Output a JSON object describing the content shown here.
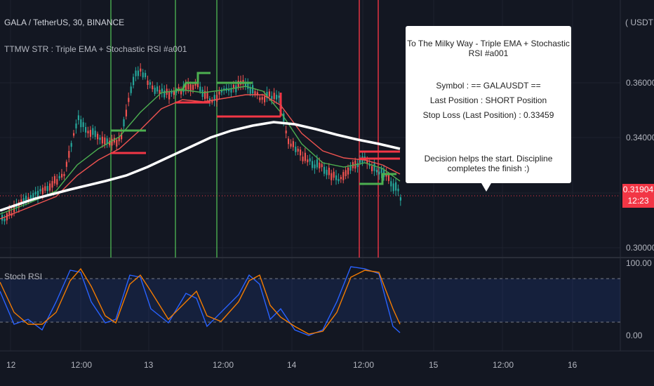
{
  "header": {
    "symbol_line": "GALA / TetherUS, 30, BINANCE",
    "strategy_line": "TTMW STR : Triple EMA + Stochastic RSI #a001",
    "currency": "( USDT )"
  },
  "price_scale": {
    "labels": [
      "0.36000",
      "0.34000",
      "0.30000"
    ],
    "last_price": "0.31904",
    "countdown": "12:23"
  },
  "popup": {
    "title": "To The Milky Way - Triple EMA + Stochastic RSI #a001",
    "symbol": "Symbol : == GALAUSDT ==",
    "last_position": "Last Position : SHORT Position",
    "stop_loss": "Stop Loss (Last Position) : 0.33459",
    "motto": "Decision helps the start. Discipline completes the finish :)"
  },
  "oscillator": {
    "title": "Stoch RSI",
    "labels": [
      "100.00",
      "0.00"
    ]
  },
  "time_axis": {
    "labels": [
      "12",
      "12:00",
      "13",
      "12:00",
      "14",
      "12:00",
      "15",
      "12:00",
      "16"
    ]
  },
  "colors": {
    "background": "#131722",
    "long_signal": "#4caf50",
    "short_signal": "#f23645",
    "ema_slow": "#ffffff",
    "stoch_k": "#2962ff",
    "stoch_d": "#f57c00"
  }
}
